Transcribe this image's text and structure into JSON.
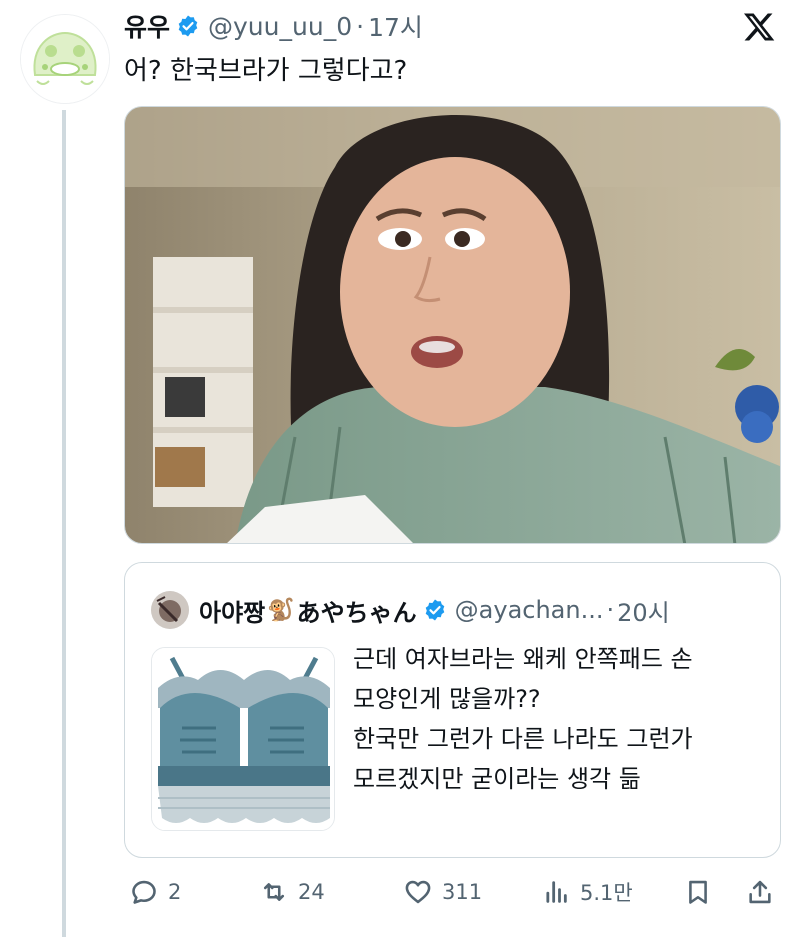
{
  "author": {
    "name": "유우",
    "handle": "@yuu_uu_0",
    "time": "17시"
  },
  "tweet": {
    "text": "어? 한국브라가 그렇다고?"
  },
  "quoted": {
    "name": "아야짱",
    "emoji": "🐒",
    "name_suffix": "あやちゃん",
    "handle": "@ayachan...",
    "time": "20시",
    "text_lines": [
      "근데 여자브라는 왜케 안쪽패드 손",
      "모양인게 많을까??",
      "한국만 그런가 다른 나라도 그런가",
      "모르겠지만 굳이라는 생각 듦"
    ]
  },
  "actions": {
    "replies": "2",
    "retweets": "24",
    "likes": "311",
    "views": "5.1만"
  },
  "colors": {
    "verified": "#1d9bf0",
    "secondary_text": "#536471",
    "border": "#cfd9de"
  }
}
